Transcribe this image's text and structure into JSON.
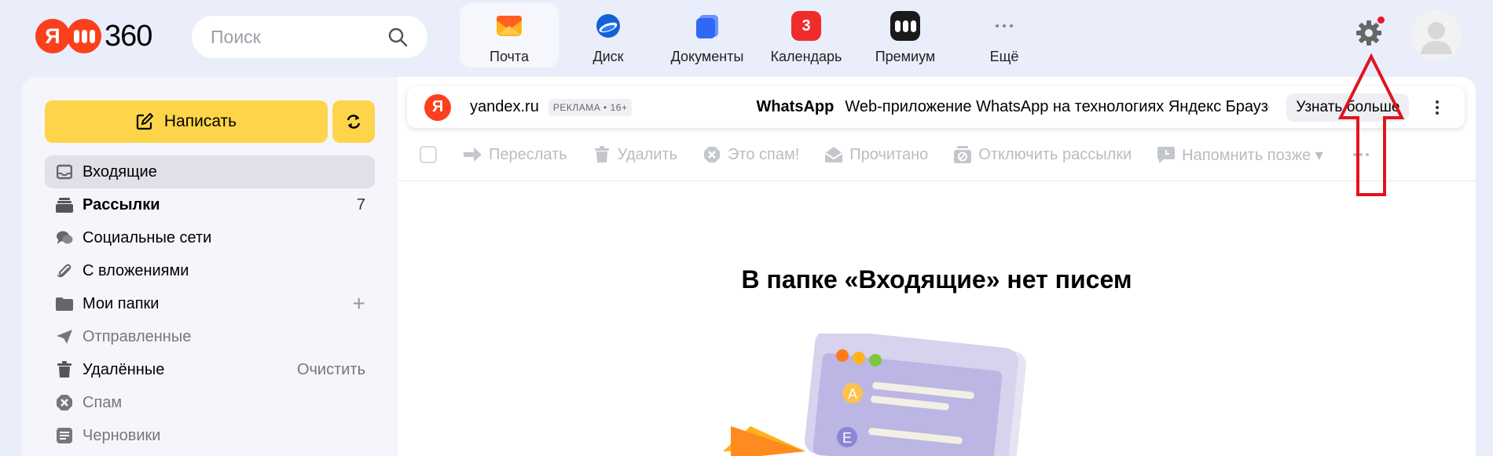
{
  "logo": {
    "ya": "Я",
    "number": "360"
  },
  "search": {
    "placeholder": "Поиск"
  },
  "apps": [
    {
      "label": "Почта",
      "icon": "mail-icon",
      "active": true
    },
    {
      "label": "Диск",
      "icon": "disk-icon"
    },
    {
      "label": "Документы",
      "icon": "documents-icon"
    },
    {
      "label": "Календарь",
      "icon": "calendar-icon",
      "badge": "3"
    },
    {
      "label": "Премиум",
      "icon": "premium-icon"
    },
    {
      "label": "Ещё",
      "icon": "more-icon"
    }
  ],
  "sidebar": {
    "compose_label": "Написать",
    "folders": [
      {
        "name": "Входящие",
        "icon": "inbox-icon",
        "active": true
      },
      {
        "name": "Рассылки",
        "icon": "newsletters-icon",
        "count": "7",
        "bold": true
      },
      {
        "name": "Социальные сети",
        "icon": "social-icon"
      },
      {
        "name": "С вложениями",
        "icon": "attachment-icon"
      },
      {
        "name": "Мои папки",
        "icon": "folder-icon",
        "action": "+"
      },
      {
        "name": "Отправленные",
        "icon": "sent-icon",
        "muted": true
      },
      {
        "name": "Удалённые",
        "icon": "trash-icon",
        "action": "Очистить"
      },
      {
        "name": "Спам",
        "icon": "spam-icon",
        "muted": true
      },
      {
        "name": "Черновики",
        "icon": "drafts-icon",
        "muted": true
      }
    ]
  },
  "ad": {
    "logo": "Я",
    "domain": "yandex.ru",
    "tag": "РЕКЛАМА • 16+",
    "title": "WhatsApp",
    "text": "Web-приложение WhatsApp на технологиях Яндекс Браузе",
    "button": "Узнать больше"
  },
  "toolbar": {
    "forward": "Переслать",
    "delete": "Удалить",
    "spam": "Это спам!",
    "read": "Прочитано",
    "unsubscribe": "Отключить рассылки",
    "remind": "Напомнить позже ▾"
  },
  "empty_message": "В папке «Входящие» нет писем",
  "colors": {
    "accent_yellow": "#fed44a",
    "brand_red": "#fc3f1d",
    "background": "#e9eefa",
    "annotation_arrow": "#e0151f"
  }
}
